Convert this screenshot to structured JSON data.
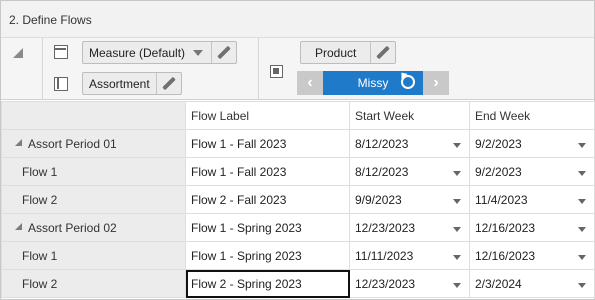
{
  "window": {
    "title": "2. Define Flows"
  },
  "pivot": {
    "rows": [
      {
        "label": "Measure (Default)",
        "icon": "columns-icon"
      },
      {
        "label": "Assortment",
        "icon": "rows-icon"
      }
    ],
    "columns": {
      "label": "Product"
    },
    "page": {
      "value": "Missy"
    }
  },
  "grid": {
    "headers": [
      "Flow Label",
      "Start Week",
      "End Week"
    ],
    "rows": [
      {
        "name": "Assort Period 01",
        "level": 1,
        "flow_label": "Flow 1 - Fall 2023",
        "start": "8/12/2023",
        "end": "9/2/2023"
      },
      {
        "name": "Flow 1",
        "level": 2,
        "flow_label": "Flow 1 - Fall 2023",
        "start": "8/12/2023",
        "end": "9/2/2023"
      },
      {
        "name": "Flow 2",
        "level": 2,
        "flow_label": "Flow 2 - Fall 2023",
        "start": "9/9/2023",
        "end": "11/4/2023"
      },
      {
        "name": "Assort Period 02",
        "level": 1,
        "flow_label": "Flow 1 - Spring 2023",
        "start": "12/23/2023",
        "end": "12/16/2023"
      },
      {
        "name": "Flow 1",
        "level": 2,
        "flow_label": "Flow 1 - Spring 2023",
        "start": "11/11/2023",
        "end": "12/16/2023"
      },
      {
        "name": "Flow 2",
        "level": 2,
        "flow_label": "Flow 2 - Spring 2023",
        "start": "12/23/2023",
        "end": "2/3/2024"
      }
    ]
  }
}
